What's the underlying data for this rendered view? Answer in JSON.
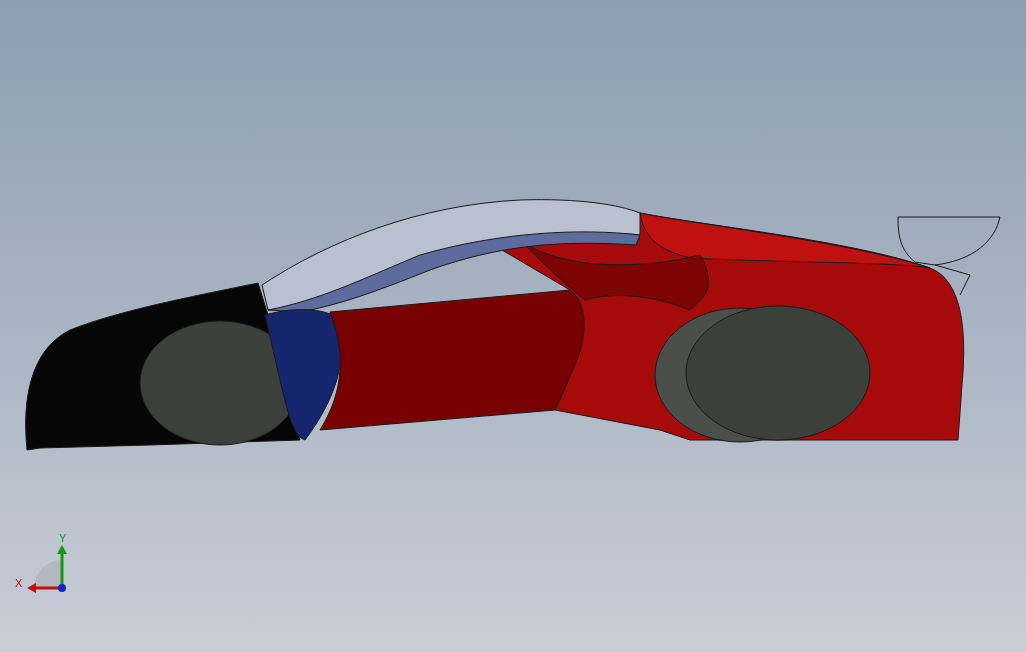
{
  "triad": {
    "x_label": "X",
    "y_label": "Y"
  }
}
